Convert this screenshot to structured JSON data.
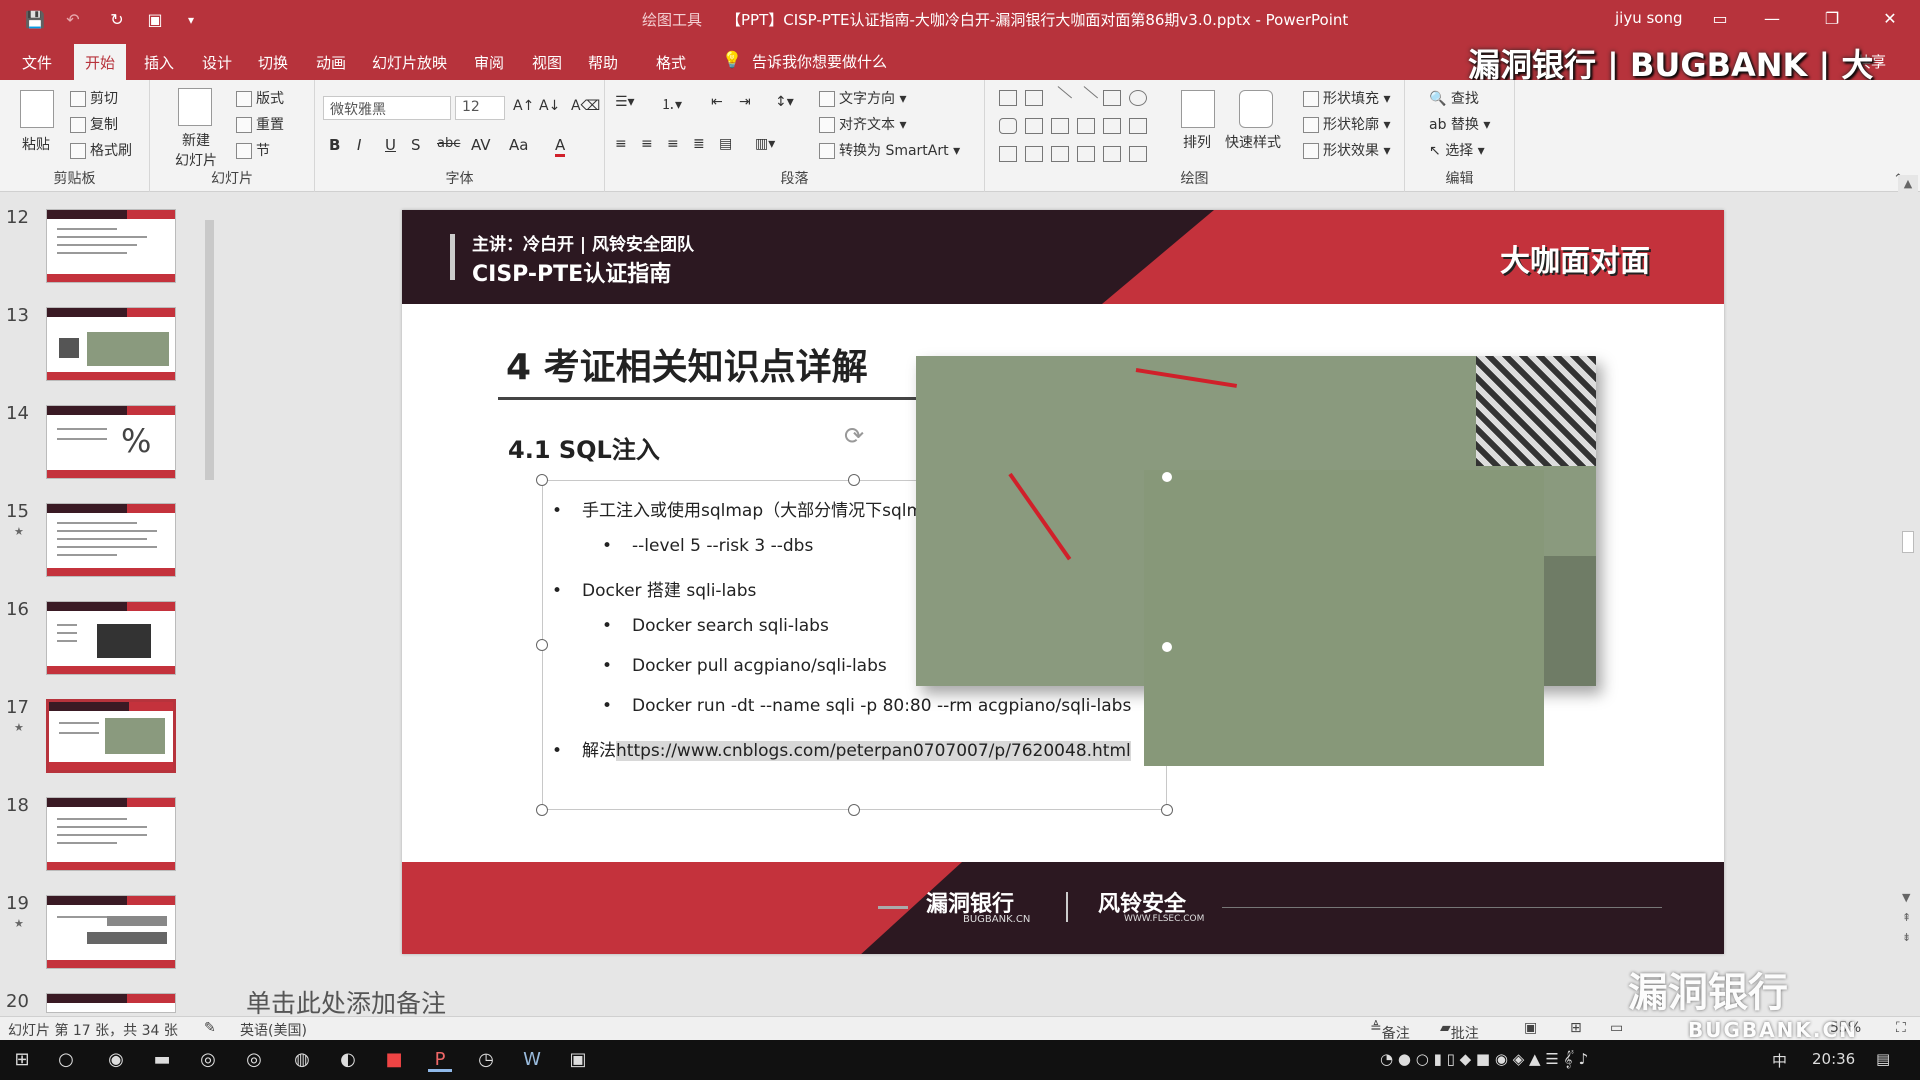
{
  "titlebar": {
    "context_label": "绘图工具",
    "document_title": "【PPT】CISP-PTE认证指南-大咖冷白开-漏洞银行大咖面对面第86期v3.0.pptx - PowerPoint",
    "user": "jiyu song"
  },
  "menu": {
    "tabs": [
      "文件",
      "开始",
      "插入",
      "设计",
      "切换",
      "动画",
      "幻灯片放映",
      "审阅",
      "视图",
      "帮助",
      "格式"
    ],
    "active_tab": "开始",
    "tell_me": "告诉我你想要做什么",
    "watermark": "漏洞银行 | BUGBANK | 大咖面对面",
    "share": "共享"
  },
  "ribbon": {
    "clipboard": {
      "label": "剪贴板",
      "paste": "粘贴",
      "cut": "剪切",
      "copy": "复制",
      "format_painter": "格式刷"
    },
    "slides": {
      "label": "幻灯片",
      "new_slide": "新建\n幻灯片",
      "layout": "版式",
      "reset": "重置",
      "section": "节"
    },
    "font": {
      "label": "字体",
      "font_name": "微软雅黑",
      "font_size": "12",
      "bold": "B",
      "italic": "I",
      "underline": "U",
      "shadow": "S",
      "strike": "abc",
      "spacing": "AV",
      "case": "Aa",
      "color": "A"
    },
    "paragraph": {
      "label": "段落",
      "text_direction": "文字方向",
      "align_text": "对齐文本",
      "smartart": "转换为 SmartArt"
    },
    "drawing": {
      "label": "绘图",
      "arrange": "排列",
      "quick_styles": "快速样式",
      "fill": "形状填充",
      "outline": "形状轮廓",
      "effects": "形状效果"
    },
    "editing": {
      "label": "编辑",
      "find": "查找",
      "replace": "替换",
      "select": "选择"
    }
  },
  "thumbnails": {
    "numbers": [
      "12",
      "13",
      "14",
      "15",
      "16",
      "17",
      "18",
      "19",
      "20"
    ],
    "starred": [
      "15",
      "17",
      "19"
    ],
    "selected": "17"
  },
  "slide": {
    "header_line1": "主讲：冷白开 | 风铃安全团队",
    "header_line2": "CISP-PTE认证指南",
    "header_brand": "大咖面对面",
    "title": "4 考证相关知识点详解",
    "subtitle": "4.1 SQL注入",
    "bullets": [
      {
        "level": 1,
        "text": "手工注入或使用sqlmap（大部分情况下sqlma"
      },
      {
        "level": 2,
        "text": "--level 5 --risk 3 --dbs"
      },
      {
        "level": 1,
        "text": "Docker 搭建 sqli-labs"
      },
      {
        "level": 2,
        "text": "Docker search sqli-labs"
      },
      {
        "level": 2,
        "text": "Docker pull acgpiano/sqli-labs"
      },
      {
        "level": 2,
        "text": "Docker run -dt --name sqli -p 80:80 --rm acgpiano/sqli-labs"
      },
      {
        "level": 1,
        "text": "解法",
        "link": "https://www.cnblogs.com/peterpan0707007/p/7620048.html"
      }
    ],
    "footer_logo1": "漏洞银行",
    "footer_logo1_sub": "BUGBANK.CN",
    "footer_logo2": "风铃安全",
    "footer_logo2_sub": "WWW.FLSEC.COM"
  },
  "notes_placeholder": "单击此处添加备注",
  "status": {
    "slide_info": "幻灯片 第 17 张，共 34 张",
    "language": "英语(美国)",
    "notes": "备注",
    "comments": "批注",
    "zoom": "55%"
  },
  "watermark_br": {
    "title": "漏洞银行",
    "sub": "BUGBANK.CN"
  },
  "taskbar": {
    "ime": "中",
    "clock": "20:36"
  },
  "colors": {
    "accent": "#b7333c",
    "slide_dark": "#2c1821",
    "slide_red": "#c4323c"
  }
}
